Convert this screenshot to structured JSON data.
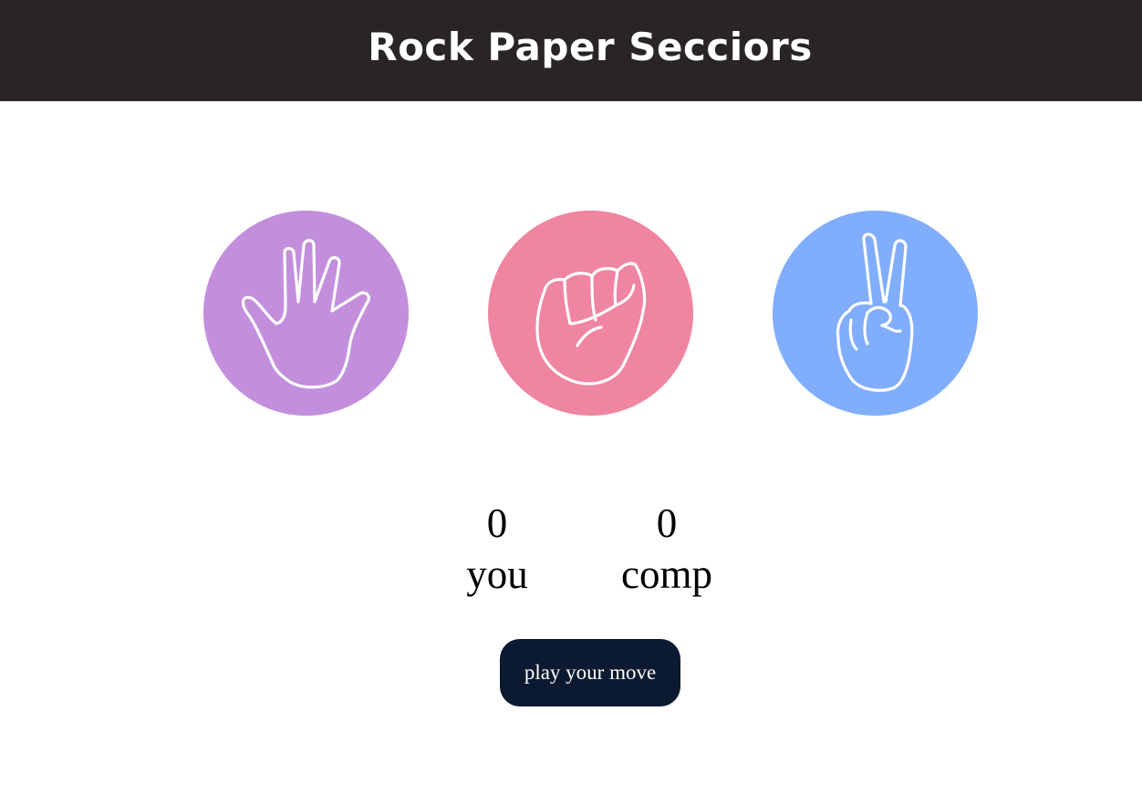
{
  "header": {
    "title": "Rock Paper Secciors"
  },
  "choices": [
    {
      "id": "paper",
      "icon": "open-hand-icon",
      "color": "#c38fdd"
    },
    {
      "id": "rock",
      "icon": "fist-icon",
      "color": "#ef85a1"
    },
    {
      "id": "scissors",
      "icon": "peace-hand-icon",
      "color": "#80aefc"
    }
  ],
  "scoreboard": {
    "user": {
      "score": "0",
      "label": "you"
    },
    "comp": {
      "score": "0",
      "label": "comp"
    }
  },
  "msg": {
    "label": "play your move",
    "color": "#0b1a30"
  }
}
